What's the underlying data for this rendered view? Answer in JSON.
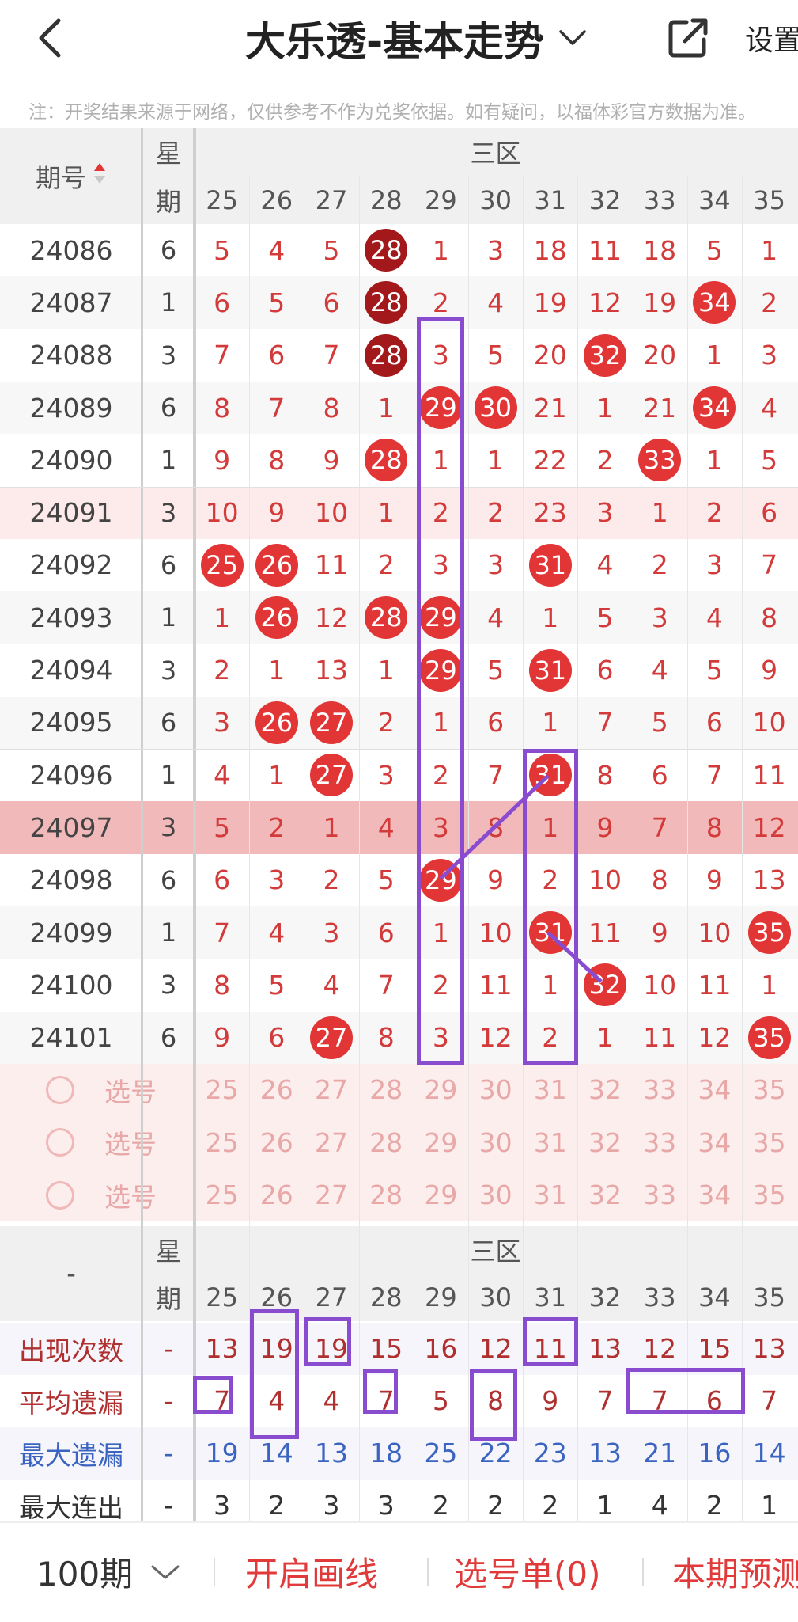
{
  "header": {
    "title": "大乐透-基本走势",
    "settings": "设置"
  },
  "notice": "注：开奖结果来源于网络，仅供参考不作为兑奖依据。如有疑问，以福体彩官方数据为准。",
  "table": {
    "issue_header": "期号",
    "week_header_1": "星",
    "week_header_2": "期",
    "zone_label": "三区",
    "columns": [
      "25",
      "26",
      "27",
      "28",
      "29",
      "30",
      "31",
      "32",
      "33",
      "34",
      "35"
    ],
    "rows": [
      {
        "issue": "24086",
        "week": "6",
        "cells": [
          "5",
          "4",
          "5",
          "28",
          "1",
          "3",
          "18",
          "11",
          "18",
          "5",
          "1"
        ]
      },
      {
        "issue": "24087",
        "week": "1",
        "cells": [
          "6",
          "5",
          "6",
          "28",
          "2",
          "4",
          "19",
          "12",
          "19",
          "34",
          "2"
        ]
      },
      {
        "issue": "24088",
        "week": "3",
        "cells": [
          "7",
          "6",
          "7",
          "28",
          "3",
          "5",
          "20",
          "32",
          "20",
          "1",
          "3"
        ]
      },
      {
        "issue": "24089",
        "week": "6",
        "cells": [
          "8",
          "7",
          "8",
          "1",
          "29",
          "30",
          "21",
          "1",
          "21",
          "34",
          "4"
        ]
      },
      {
        "issue": "24090",
        "week": "1",
        "cells": [
          "9",
          "8",
          "9",
          "28",
          "1",
          "1",
          "22",
          "2",
          "33",
          "1",
          "5"
        ]
      },
      {
        "issue": "24091",
        "week": "3",
        "cells": [
          "10",
          "9",
          "10",
          "1",
          "2",
          "2",
          "23",
          "3",
          "1",
          "2",
          "6"
        ]
      },
      {
        "issue": "24092",
        "week": "6",
        "cells": [
          "25",
          "26",
          "11",
          "2",
          "3",
          "3",
          "31",
          "4",
          "2",
          "3",
          "7"
        ]
      },
      {
        "issue": "24093",
        "week": "1",
        "cells": [
          "1",
          "26",
          "12",
          "28",
          "29",
          "4",
          "1",
          "5",
          "3",
          "4",
          "8"
        ]
      },
      {
        "issue": "24094",
        "week": "3",
        "cells": [
          "2",
          "1",
          "13",
          "1",
          "29",
          "5",
          "31",
          "6",
          "4",
          "5",
          "9"
        ]
      },
      {
        "issue": "24095",
        "week": "6",
        "cells": [
          "3",
          "26",
          "27",
          "2",
          "1",
          "6",
          "1",
          "7",
          "5",
          "6",
          "10"
        ]
      },
      {
        "issue": "24096",
        "week": "1",
        "cells": [
          "4",
          "1",
          "27",
          "3",
          "2",
          "7",
          "31",
          "8",
          "6",
          "7",
          "11"
        ]
      },
      {
        "issue": "24097",
        "week": "3",
        "cells": [
          "5",
          "2",
          "1",
          "4",
          "3",
          "8",
          "1",
          "9",
          "7",
          "8",
          "12"
        ]
      },
      {
        "issue": "24098",
        "week": "6",
        "cells": [
          "6",
          "3",
          "2",
          "5",
          "29",
          "9",
          "2",
          "10",
          "8",
          "9",
          "13"
        ]
      },
      {
        "issue": "24099",
        "week": "1",
        "cells": [
          "7",
          "4",
          "3",
          "6",
          "1",
          "10",
          "31",
          "11",
          "9",
          "10",
          "35"
        ]
      },
      {
        "issue": "24100",
        "week": "3",
        "cells": [
          "8",
          "5",
          "4",
          "7",
          "2",
          "11",
          "1",
          "32",
          "10",
          "11",
          "1"
        ]
      },
      {
        "issue": "24101",
        "week": "6",
        "cells": [
          "9",
          "6",
          "27",
          "8",
          "3",
          "12",
          "2",
          "1",
          "11",
          "12",
          "35"
        ]
      }
    ],
    "pick_label": "选号",
    "stats_corner": "-",
    "stats": [
      {
        "label": "出现次数",
        "week": "-",
        "color": "#b03030",
        "values": [
          "13",
          "19",
          "19",
          "15",
          "16",
          "12",
          "11",
          "13",
          "12",
          "15",
          "13"
        ]
      },
      {
        "label": "平均遗漏",
        "week": "-",
        "color": "#b03030",
        "values": [
          "7",
          "4",
          "4",
          "7",
          "5",
          "8",
          "9",
          "7",
          "7",
          "6",
          "7"
        ]
      },
      {
        "label": "最大遗漏",
        "week": "-",
        "color": "#3a64c0",
        "values": [
          "19",
          "14",
          "13",
          "18",
          "25",
          "22",
          "23",
          "13",
          "21",
          "16",
          "14"
        ]
      },
      {
        "label": "最大连出",
        "week": "-",
        "color": "#333333",
        "values": [
          "3",
          "2",
          "3",
          "3",
          "2",
          "2",
          "2",
          "1",
          "4",
          "2",
          "1"
        ]
      }
    ]
  },
  "bottom": {
    "periods": "100期",
    "draw_line": "开启画线",
    "pick_list": "选号单(0)",
    "predict": "本期预测"
  },
  "colors": {
    "ball_red": "#e23535",
    "ball_dark": "#a3191b",
    "accent": "#e03a3a",
    "highlight_row": "#f2b9bb",
    "line_purple": "#8a4ccf"
  }
}
